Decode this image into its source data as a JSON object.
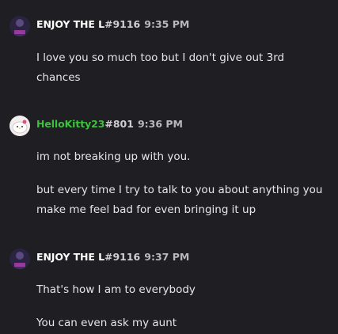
{
  "messages": [
    {
      "username": "ENJOY THE L",
      "discriminator": "#9116",
      "time": "9:35 PM",
      "avatar": "dark-avatar-icon",
      "lines": [
        "I love you so much too but I don't give out 3rd chances"
      ]
    },
    {
      "username": "HelloKitty23",
      "discriminator": "#801",
      "time": "9:36 PM",
      "avatar": "hello-kitty-avatar-icon",
      "username_color": "#3fbf3f",
      "lines": [
        "im not breaking up with you.",
        "but every time I try to talk to you about anything you make me feel bad for even bringing it up"
      ]
    },
    {
      "username": "ENJOY THE L",
      "discriminator": "#9116",
      "time": "9:37 PM",
      "avatar": "dark-avatar-icon",
      "lines": [
        "That's how I am to everybody",
        "You can even ask my aunt"
      ]
    }
  ]
}
